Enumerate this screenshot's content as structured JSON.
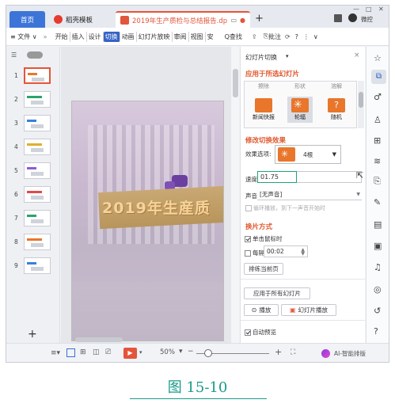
{
  "tabs": {
    "home": "首页",
    "template": "稻壳模板",
    "document": "2019年生产质检与总结报告.dps",
    "add": "+"
  },
  "window": {
    "user": "微控",
    "minimize": "—",
    "maximize": "□",
    "close": "✕"
  },
  "menubar": {
    "file": "≡ 文件 ∨",
    "more": "»",
    "items": [
      "开始",
      "插入",
      "设计",
      "切换",
      "动画",
      "幻灯片放映",
      "审阅",
      "视图",
      "安"
    ],
    "active_index": 3,
    "search": "Q查找",
    "annotate": "批注",
    "help": "?"
  },
  "slides": {
    "numbers": [
      "1",
      "2",
      "3",
      "4",
      "5",
      "6",
      "7",
      "8",
      "9"
    ],
    "selected": 0,
    "add": "+"
  },
  "slide": {
    "title": "2019年生産质"
  },
  "panel": {
    "header": "幻灯片切换",
    "section_apply": "应用于所选幻灯片",
    "effects_top": [
      "擦除",
      "形状",
      "溶解"
    ],
    "effects": [
      {
        "label": "新闻快报",
        "color": "#e8762b"
      },
      {
        "label": "轮辐",
        "color": "#e8762b"
      },
      {
        "label": "随机",
        "color": "#e8762b"
      }
    ],
    "selected_effect": 1,
    "section_modify": "修改切换效果",
    "effect_option_label": "效果选项:",
    "effect_option_value": "4根",
    "speed_label": "速度:",
    "speed_value": "01.75",
    "sound_label": "声音:",
    "sound_value": "[无声音]",
    "loop_label": "循环播放，到下一声音开始时",
    "section_switch": "换片方式",
    "on_click_label": "单击鼠标时",
    "every_label": "每隔",
    "every_value": "00:02",
    "rehearse_button": "排练当前页",
    "apply_all_button": "应用于所有幻灯片",
    "play_button": "播放",
    "slideshow_button": "幻灯片播放",
    "autopreview_label": "自动预览"
  },
  "statusbar": {
    "zoom": "50%",
    "minus": "−",
    "plus": "+",
    "ai": "AI-智能排版"
  },
  "caption": "图 15-10",
  "colors": {
    "accent": "#e0562b",
    "active_menu": "#3563c7",
    "home_tab": "#3d74d8",
    "focus": "#1fa37d",
    "caption": "#1a9a8a"
  }
}
